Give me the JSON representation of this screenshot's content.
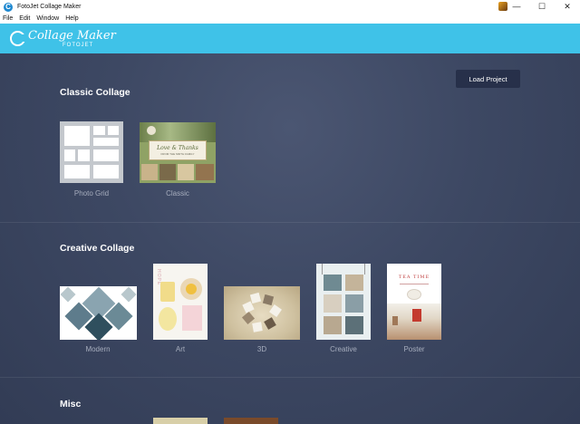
{
  "window": {
    "title": "FotoJet Collage Maker",
    "icon_letter": "C",
    "controls": {
      "minimize": "—",
      "maximize": "☐",
      "close": "✕"
    }
  },
  "menu": {
    "items": [
      "File",
      "Edit",
      "Window",
      "Help"
    ]
  },
  "brand": {
    "name": "Collage Maker",
    "sub": "FOTOJET"
  },
  "actions": {
    "load_project": "Load Project"
  },
  "sections": {
    "classic": {
      "title": "Classic Collage",
      "cards": [
        {
          "label": "Photo Grid"
        },
        {
          "label": "Classic"
        }
      ]
    },
    "creative": {
      "title": "Creative Collage",
      "cards": [
        {
          "label": "Modern"
        },
        {
          "label": "Art"
        },
        {
          "label": "3D"
        },
        {
          "label": "Creative"
        },
        {
          "label": "Poster"
        }
      ]
    },
    "misc": {
      "title": "Misc"
    }
  },
  "thumb_text": {
    "classic_banner": "Love & Thanks",
    "classic_banner_sub": "FROM THE SMITH FAMILY",
    "art_word": "HOPE",
    "poster_title": "TEA TIME"
  },
  "colors": {
    "brand_bar": "#3fc2e8",
    "background": "#3a4560",
    "button": "#27304a"
  }
}
